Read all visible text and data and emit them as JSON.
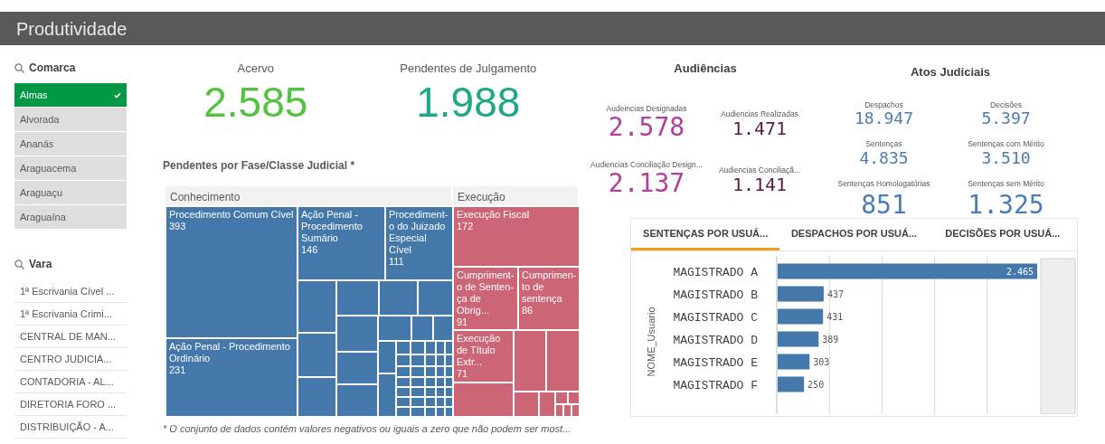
{
  "header": {
    "title": "Produtividade"
  },
  "comarca": {
    "title": "Comarca",
    "items": [
      {
        "label": "Almas",
        "selected": true
      },
      {
        "label": "Alvorada",
        "selected": false
      },
      {
        "label": "Ananás",
        "selected": false
      },
      {
        "label": "Araguacema",
        "selected": false
      },
      {
        "label": "Araguaçu",
        "selected": false
      },
      {
        "label": "Araguaína",
        "selected": false
      }
    ]
  },
  "vara": {
    "title": "Vara",
    "items": [
      {
        "label": "1ª Escrivania Cível ...",
        "selected": false
      },
      {
        "label": "1ª Escrivania Crimi...",
        "selected": false
      },
      {
        "label": "CENTRAL DE MAN...",
        "selected": false
      },
      {
        "label": "CENTRO JUDICIÁ...",
        "selected": false
      },
      {
        "label": "CONTADORIA - AL...",
        "selected": false
      },
      {
        "label": "DIRETORIA FORO ...",
        "selected": false
      },
      {
        "label": "DISTRIBUIÇÃO - A...",
        "selected": false
      }
    ]
  },
  "kpis": [
    {
      "label": "Acervo",
      "value": "2.585",
      "color": "#52c23f"
    },
    {
      "label": "Pendentes de Julgamento",
      "value": "1.988",
      "color": "#1fa886"
    }
  ],
  "treemap": {
    "title": "Pendentes por Fase/Classe Judicial *",
    "groups": [
      {
        "label": "Conhecimento",
        "color": "#4477aa",
        "tiles": [
          {
            "label": "Procedimento Comum Cível",
            "value": "393"
          },
          {
            "label": "Ação Penal - Procedimento Sumário",
            "value": "146"
          },
          {
            "label": "Procediment-o do Juizado Especial Cível",
            "value": "111"
          },
          {
            "label": "Ação Penal - Procedimento Ordinário",
            "value": "231"
          }
        ]
      },
      {
        "label": "Execução",
        "color": "#cc6677",
        "tiles": [
          {
            "label": "Execução Fiscal",
            "value": "172"
          },
          {
            "label": "Cumpriment-o de Senten-ça de Obrig...",
            "value": "91"
          },
          {
            "label": "Cumprimen-to de sentença",
            "value": "86"
          },
          {
            "label": "Execução de Título Extr...",
            "value": "71"
          }
        ]
      }
    ],
    "footnote": "* O conjunto de dados contém valores negativos ou iguais a zero que não podem ser most..."
  },
  "audiencias": {
    "title": "Audiências",
    "items": [
      {
        "label": "Audeincias Designadas",
        "value": "2.578",
        "color": "#b0409c"
      },
      {
        "label": "Audiencias Realizadas",
        "value": "1.471",
        "color": "#5c1848"
      },
      {
        "label": "Audiencias Conciliação Design...",
        "value": "2.137",
        "color": "#b0409c"
      },
      {
        "label": "Audiencias Conciliaçã...",
        "value": "1.141",
        "color": "#5c1848"
      }
    ]
  },
  "atos": {
    "title": "Atos Judiciais",
    "items": [
      {
        "label": "Despachos",
        "value": "18.947",
        "kind": "small"
      },
      {
        "label": "Decisões",
        "value": "5.397",
        "kind": "small"
      },
      {
        "label": "Sentenças",
        "value": "4.835",
        "kind": "small"
      },
      {
        "label": "Sentenças com Mérito",
        "value": "3.510",
        "kind": "small"
      },
      {
        "label": "Sentenças Homologatórias",
        "value": "851",
        "kind": "large"
      },
      {
        "label": "Sentenças sem Mérito",
        "value": "1.325",
        "kind": "large"
      }
    ]
  },
  "tabs": [
    {
      "label": "SENTENÇAS POR USUÁ...",
      "selected": true
    },
    {
      "label": "DESPACHOS POR USUÁ...",
      "selected": false
    },
    {
      "label": "DECISÕES POR USUÁ...",
      "selected": false
    }
  ],
  "chart_data": {
    "type": "bar",
    "orientation": "horizontal",
    "ylabel": "NOME_Usuario",
    "categories": [
      "MAGISTRADO A",
      "MAGISTRADO B",
      "MAGISTRADO C",
      "MAGISTRADO D",
      "MAGISTRADO E",
      "MAGISTRADO F"
    ],
    "values": [
      2465,
      437,
      431,
      389,
      303,
      250
    ],
    "value_labels": [
      "2.465",
      "437",
      "431",
      "389",
      "303",
      "250"
    ]
  }
}
